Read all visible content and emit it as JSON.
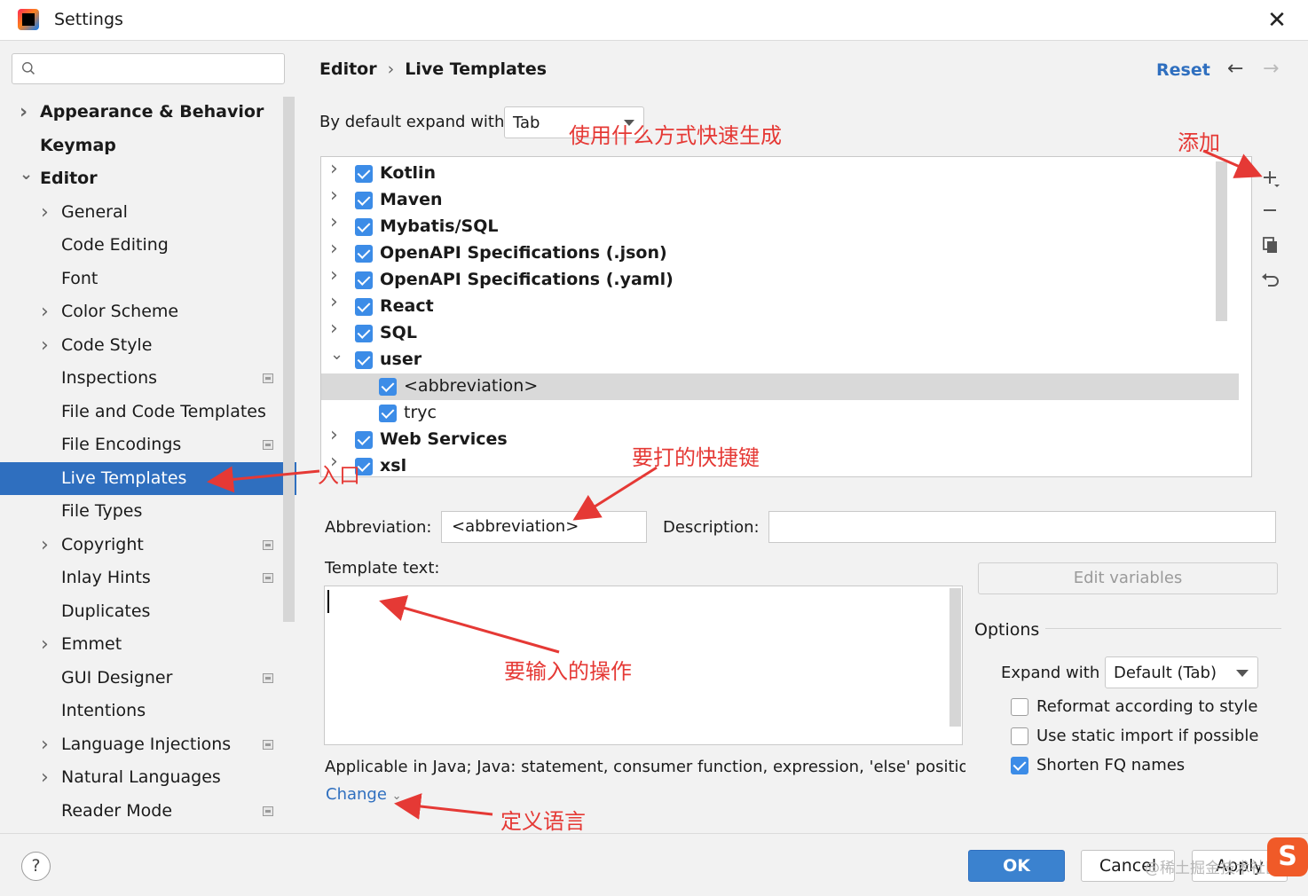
{
  "window": {
    "title": "Settings"
  },
  "sidebar": {
    "search_placeholder": "",
    "items": [
      {
        "label": "Appearance & Behavior",
        "level": 0,
        "chevron": "right",
        "bold": true,
        "page_icon": false,
        "selected": false
      },
      {
        "label": "Keymap",
        "level": 0,
        "chevron": "none",
        "bold": true,
        "page_icon": false,
        "selected": false
      },
      {
        "label": "Editor",
        "level": 0,
        "chevron": "down",
        "bold": true,
        "page_icon": false,
        "selected": false
      },
      {
        "label": "General",
        "level": 1,
        "chevron": "right",
        "bold": false,
        "page_icon": false,
        "selected": false
      },
      {
        "label": "Code Editing",
        "level": 1,
        "chevron": "none",
        "bold": false,
        "page_icon": false,
        "selected": false
      },
      {
        "label": "Font",
        "level": 1,
        "chevron": "none",
        "bold": false,
        "page_icon": false,
        "selected": false
      },
      {
        "label": "Color Scheme",
        "level": 1,
        "chevron": "right",
        "bold": false,
        "page_icon": false,
        "selected": false
      },
      {
        "label": "Code Style",
        "level": 1,
        "chevron": "right",
        "bold": false,
        "page_icon": false,
        "selected": false
      },
      {
        "label": "Inspections",
        "level": 1,
        "chevron": "none",
        "bold": false,
        "page_icon": true,
        "selected": false
      },
      {
        "label": "File and Code Templates",
        "level": 1,
        "chevron": "none",
        "bold": false,
        "page_icon": false,
        "selected": false
      },
      {
        "label": "File Encodings",
        "level": 1,
        "chevron": "none",
        "bold": false,
        "page_icon": true,
        "selected": false
      },
      {
        "label": "Live Templates",
        "level": 1,
        "chevron": "none",
        "bold": false,
        "page_icon": false,
        "selected": true
      },
      {
        "label": "File Types",
        "level": 1,
        "chevron": "none",
        "bold": false,
        "page_icon": false,
        "selected": false
      },
      {
        "label": "Copyright",
        "level": 1,
        "chevron": "right",
        "bold": false,
        "page_icon": true,
        "selected": false
      },
      {
        "label": "Inlay Hints",
        "level": 1,
        "chevron": "none",
        "bold": false,
        "page_icon": true,
        "selected": false
      },
      {
        "label": "Duplicates",
        "level": 1,
        "chevron": "none",
        "bold": false,
        "page_icon": false,
        "selected": false
      },
      {
        "label": "Emmet",
        "level": 1,
        "chevron": "right",
        "bold": false,
        "page_icon": false,
        "selected": false
      },
      {
        "label": "GUI Designer",
        "level": 1,
        "chevron": "none",
        "bold": false,
        "page_icon": true,
        "selected": false
      },
      {
        "label": "Intentions",
        "level": 1,
        "chevron": "none",
        "bold": false,
        "page_icon": false,
        "selected": false
      },
      {
        "label": "Language Injections",
        "level": 1,
        "chevron": "right",
        "bold": false,
        "page_icon": true,
        "selected": false
      },
      {
        "label": "Natural Languages",
        "level": 1,
        "chevron": "right",
        "bold": false,
        "page_icon": false,
        "selected": false
      },
      {
        "label": "Reader Mode",
        "level": 1,
        "chevron": "none",
        "bold": false,
        "page_icon": true,
        "selected": false
      }
    ]
  },
  "header": {
    "breadcrumb_parent": "Editor",
    "breadcrumb_separator": "›",
    "breadcrumb_current": "Live Templates",
    "reset_label": "Reset",
    "back_icon": "arrow-left-icon",
    "forward_icon": "arrow-right-icon"
  },
  "expand": {
    "label": "By default expand with",
    "value": "Tab"
  },
  "template_groups": [
    {
      "label": "Kotlin",
      "type": "group",
      "expanded": false,
      "checked": true,
      "selected": false
    },
    {
      "label": "Maven",
      "type": "group",
      "expanded": false,
      "checked": true,
      "selected": false
    },
    {
      "label": "Mybatis/SQL",
      "type": "group",
      "expanded": false,
      "checked": true,
      "selected": false
    },
    {
      "label": "OpenAPI Specifications (.json)",
      "type": "group",
      "expanded": false,
      "checked": true,
      "selected": false
    },
    {
      "label": "OpenAPI Specifications (.yaml)",
      "type": "group",
      "expanded": false,
      "checked": true,
      "selected": false
    },
    {
      "label": "React",
      "type": "group",
      "expanded": false,
      "checked": true,
      "selected": false
    },
    {
      "label": "SQL",
      "type": "group",
      "expanded": false,
      "checked": true,
      "selected": false
    },
    {
      "label": "user",
      "type": "group",
      "expanded": true,
      "checked": true,
      "selected": false
    },
    {
      "label": "<abbreviation>",
      "type": "template",
      "expanded": false,
      "checked": true,
      "selected": true
    },
    {
      "label": "tryc",
      "type": "template",
      "expanded": false,
      "checked": true,
      "selected": false
    },
    {
      "label": "Web Services",
      "type": "group",
      "expanded": false,
      "checked": true,
      "selected": false
    },
    {
      "label": "xsl",
      "type": "group",
      "expanded": false,
      "checked": true,
      "selected": false
    }
  ],
  "list_tools": [
    "add-icon",
    "remove-icon",
    "copy-icon",
    "restore-icon"
  ],
  "editor": {
    "abbreviation_label": "Abbreviation:",
    "abbreviation_value": "<abbreviation>",
    "description_label": "Description:",
    "description_value": "",
    "template_text_label": "Template text:",
    "template_text_value": "",
    "edit_variables_label": "Edit variables",
    "applicable_text": "Applicable in Java; Java: statement, consumer function, expression, 'else' position, d...",
    "change_label": "Change"
  },
  "options": {
    "title": "Options",
    "expand_with_label": "Expand with",
    "expand_with_value": "Default (Tab)",
    "reformat_label": "Reformat according to style",
    "reformat_checked": false,
    "static_import_label": "Use static import if possible",
    "static_import_checked": false,
    "shorten_fq_label": "Shorten FQ names",
    "shorten_fq_checked": true
  },
  "footer": {
    "help_label": "?",
    "ok_label": "OK",
    "cancel_label": "Cancel",
    "apply_label": "Apply",
    "watermark": "@稀土掘金技术社区",
    "logo_letter": "S"
  },
  "annotations": {
    "expand_note": "使用什么方式快速生成",
    "add_note": "添加",
    "entry_note": "入口",
    "shortcut_note": "要打的快捷键",
    "operation_note": "要输入的操作",
    "language_note": "定义语言"
  },
  "colors": {
    "accent": "#2f6fbf",
    "checkbox": "#3c8ce7",
    "annotation": "#e53935",
    "selection": "#d9d9d9"
  }
}
